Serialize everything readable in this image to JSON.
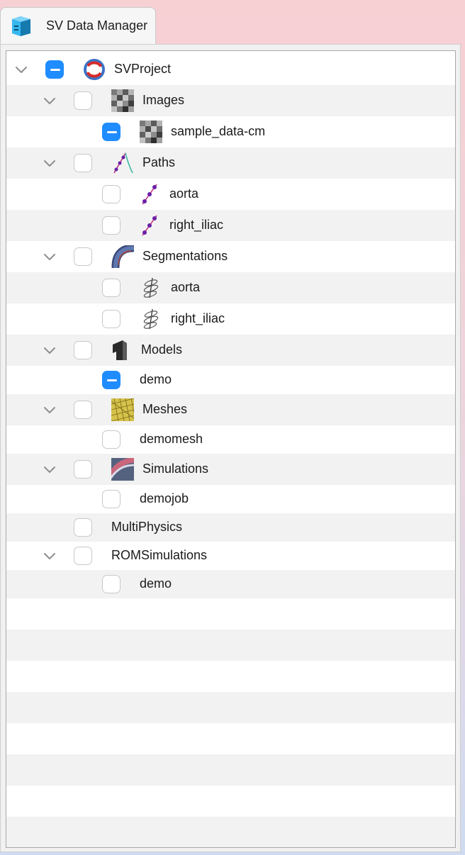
{
  "tab": {
    "title": "SV Data Manager",
    "icon": "data-manager-icon"
  },
  "accent_color": "#1f8cff",
  "tree": {
    "project": {
      "label": "SVProject",
      "expanded": true,
      "check": "partial",
      "icon": "svproject-logo-icon"
    },
    "images": {
      "label": "Images",
      "expanded": true,
      "check": "unchecked",
      "icon": "image-checker-icon",
      "items": [
        {
          "label": "sample_data-cm",
          "check": "partial",
          "icon": "image-checker-icon"
        }
      ]
    },
    "paths": {
      "label": "Paths",
      "expanded": true,
      "check": "unchecked",
      "icon": "path-icon",
      "items": [
        {
          "label": "aorta",
          "check": "unchecked",
          "icon": "path-points-icon"
        },
        {
          "label": "right_iliac",
          "check": "unchecked",
          "icon": "path-points-icon"
        }
      ]
    },
    "segmentations": {
      "label": "Segmentations",
      "expanded": true,
      "check": "unchecked",
      "icon": "segmentation-tube-icon",
      "items": [
        {
          "label": "aorta",
          "check": "unchecked",
          "icon": "contour-rings-icon"
        },
        {
          "label": "right_iliac",
          "check": "unchecked",
          "icon": "contour-rings-icon"
        }
      ]
    },
    "models": {
      "label": "Models",
      "expanded": true,
      "check": "unchecked",
      "icon": "model-solid-icon",
      "items": [
        {
          "label": "demo",
          "check": "partial"
        }
      ]
    },
    "meshes": {
      "label": "Meshes",
      "expanded": true,
      "check": "unchecked",
      "icon": "mesh-icon",
      "items": [
        {
          "label": "demomesh",
          "check": "unchecked"
        }
      ]
    },
    "simulations": {
      "label": "Simulations",
      "expanded": true,
      "check": "unchecked",
      "icon": "simulation-flow-icon",
      "items": [
        {
          "label": "demojob",
          "check": "unchecked"
        }
      ]
    },
    "multiphysics": {
      "label": "MultiPhysics",
      "check": "unchecked"
    },
    "romsimulations": {
      "label": "ROMSimulations",
      "expanded": true,
      "check": "unchecked",
      "items": [
        {
          "label": "demo",
          "check": "unchecked"
        }
      ]
    }
  }
}
